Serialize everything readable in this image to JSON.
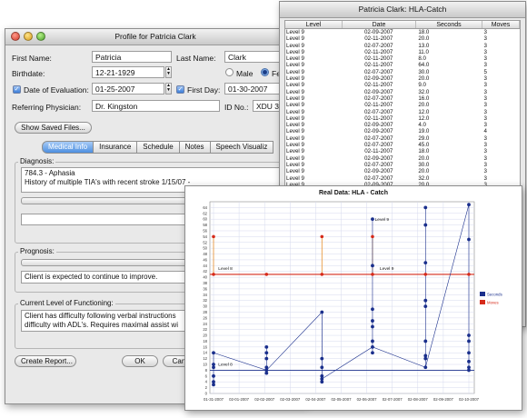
{
  "profile": {
    "title": "Profile for Patricia Clark",
    "first_name_label": "First Name:",
    "first_name": "Patricia",
    "last_name_label": "Last Name:",
    "last_name": "Clark",
    "birthdate_label": "Birthdate:",
    "birthdate": "12-21-1929",
    "gender_male": "Male",
    "gender_female": "Fe",
    "eval_label": "Date of Evaluation:",
    "eval_date": "01-25-2007",
    "first_day_label": "First Day:",
    "first_day": "01-30-2007",
    "physician_label": "Referring Physician:",
    "physician": "Dr. Kingston",
    "id_label": "ID No.:",
    "id_value": "XDU 34",
    "show_files": "Show Saved Files...",
    "tabs": [
      "Medical Info",
      "Insurance",
      "Schedule",
      "Notes",
      "Speech Visualiz"
    ],
    "diagnosis_label": "Diagnosis:",
    "diagnosis_line1": "784.3 - Aphasia",
    "diagnosis_line2": "History of multiple TIA's with recent stroke 1/15/07 -",
    "prognosis_label": "Prognosis:",
    "prognosis_text": "Client is expected to continue to improve.",
    "functioning_label": "Current Level of Functioning:",
    "functioning_line1": "Client has difficulty following verbal instructions",
    "functioning_line2": "difficulty with ADL's. Requires maximal assist wi",
    "create_report": "Create Report...",
    "ok": "OK",
    "cancel": "Canc"
  },
  "table": {
    "title": "Patricia Clark: HLA-Catch",
    "columns": [
      "Level",
      "Date",
      "Seconds",
      "Moves"
    ],
    "rows": [
      [
        "Level 9",
        "02-09-2007",
        "18.0",
        "3"
      ],
      [
        "Level 9",
        "02-11-2007",
        "20.0",
        "3"
      ],
      [
        "Level 9",
        "02-07-2007",
        "13.0",
        "3"
      ],
      [
        "Level 9",
        "02-11-2007",
        "11.0",
        "3"
      ],
      [
        "Level 9",
        "02-11-2007",
        "8.0",
        "3"
      ],
      [
        "Level 9",
        "02-11-2007",
        "64.0",
        "3"
      ],
      [
        "Level 9",
        "02-07-2007",
        "30.0",
        "5"
      ],
      [
        "Level 9",
        "02-09-2007",
        "20.0",
        "3"
      ],
      [
        "Level 9",
        "02-11-2007",
        "9.0",
        "3"
      ],
      [
        "Level 9",
        "02-09-2007",
        "32.0",
        "3"
      ],
      [
        "Level 9",
        "02-07-2007",
        "16.0",
        "3"
      ],
      [
        "Level 9",
        "02-11-2007",
        "20.0",
        "3"
      ],
      [
        "Level 9",
        "02-07-2007",
        "12.0",
        "3"
      ],
      [
        "Level 9",
        "02-11-2007",
        "12.0",
        "3"
      ],
      [
        "Level 9",
        "02-09-2007",
        "4.0",
        "3"
      ],
      [
        "Level 9",
        "02-09-2007",
        "19.0",
        "4"
      ],
      [
        "Level 9",
        "02-07-2007",
        "29.0",
        "3"
      ],
      [
        "Level 9",
        "02-07-2007",
        "45.0",
        "3"
      ],
      [
        "Level 9",
        "02-11-2007",
        "18.0",
        "3"
      ],
      [
        "Level 9",
        "02-09-2007",
        "20.0",
        "3"
      ],
      [
        "Level 9",
        "02-07-2007",
        "30.0",
        "3"
      ],
      [
        "Level 9",
        "02-09-2007",
        "20.0",
        "3"
      ],
      [
        "Level 9",
        "02-07-2007",
        "32.0",
        "3"
      ],
      [
        "Level 9",
        "02-09-2007",
        "20.0",
        "3"
      ],
      [
        "Level 9",
        "02-11-2007",
        "14.0",
        "3"
      ]
    ]
  },
  "chart_data": {
    "type": "scatter",
    "title": "Real Data: HLA - Catch",
    "x_ticks": [
      "01-31-2007",
      "02-01-2007",
      "02-02-2007",
      "02-03-2007",
      "02-04-2007",
      "02-05-2007",
      "02-06-2007",
      "02-07-2007",
      "02-08-2007",
      "02-09-2007",
      "02-10-2007"
    ],
    "y_ticks_left": [
      0,
      2,
      4,
      6,
      8,
      10,
      12,
      14,
      16,
      18,
      20,
      22,
      24,
      26,
      28,
      30,
      32,
      34,
      36,
      38,
      40,
      42,
      44,
      46,
      48,
      50,
      52,
      54,
      56,
      58,
      60,
      62,
      64
    ],
    "ylim": [
      0,
      66
    ],
    "legend": [
      "Seconds",
      "Moves"
    ],
    "legend_colors": [
      "#1a2f8c",
      "#d62a1a"
    ],
    "annotations": [
      "Level 8",
      "Level 9",
      "Level 9",
      "Level 8"
    ],
    "seconds_points": [
      {
        "x": 0,
        "y": 14
      },
      {
        "x": 0,
        "y": 10
      },
      {
        "x": 0,
        "y": 9
      },
      {
        "x": 0,
        "y": 6
      },
      {
        "x": 0,
        "y": 4
      },
      {
        "x": 0,
        "y": 3
      },
      {
        "x": 2.2,
        "y": 16
      },
      {
        "x": 2.2,
        "y": 14
      },
      {
        "x": 2.2,
        "y": 12
      },
      {
        "x": 2.2,
        "y": 9
      },
      {
        "x": 2.2,
        "y": 8
      },
      {
        "x": 2.2,
        "y": 7
      },
      {
        "x": 4.5,
        "y": 28
      },
      {
        "x": 4.5,
        "y": 12
      },
      {
        "x": 4.5,
        "y": 9
      },
      {
        "x": 4.5,
        "y": 6
      },
      {
        "x": 4.5,
        "y": 5
      },
      {
        "x": 4.5,
        "y": 4
      },
      {
        "x": 6.6,
        "y": 60
      },
      {
        "x": 6.6,
        "y": 44
      },
      {
        "x": 6.6,
        "y": 29
      },
      {
        "x": 6.6,
        "y": 25
      },
      {
        "x": 6.6,
        "y": 23
      },
      {
        "x": 6.6,
        "y": 18
      },
      {
        "x": 6.6,
        "y": 16
      },
      {
        "x": 6.6,
        "y": 14
      },
      {
        "x": 8.8,
        "y": 64
      },
      {
        "x": 8.8,
        "y": 58
      },
      {
        "x": 8.8,
        "y": 45
      },
      {
        "x": 8.8,
        "y": 32
      },
      {
        "x": 8.8,
        "y": 30
      },
      {
        "x": 8.8,
        "y": 18
      },
      {
        "x": 8.8,
        "y": 13
      },
      {
        "x": 8.8,
        "y": 12
      },
      {
        "x": 8.8,
        "y": 9
      },
      {
        "x": 10.6,
        "y": 65
      },
      {
        "x": 10.6,
        "y": 53
      },
      {
        "x": 10.6,
        "y": 20
      },
      {
        "x": 10.6,
        "y": 18
      },
      {
        "x": 10.6,
        "y": 14
      },
      {
        "x": 10.6,
        "y": 11
      },
      {
        "x": 10.6,
        "y": 9
      },
      {
        "x": 10.6,
        "y": 8
      }
    ],
    "seconds_line": [
      {
        "x": 0,
        "y": 14
      },
      {
        "x": 2.2,
        "y": 8
      },
      {
        "x": 4.5,
        "y": 28
      },
      {
        "x": 4.5,
        "y": 5
      },
      {
        "x": 6.6,
        "y": 16
      },
      {
        "x": 8.8,
        "y": 9
      },
      {
        "x": 10.6,
        "y": 65
      }
    ],
    "moves_points": [
      {
        "x": 0,
        "y": 54
      },
      {
        "x": 0,
        "y": 41
      },
      {
        "x": 2.2,
        "y": 41
      },
      {
        "x": 4.5,
        "y": 54
      },
      {
        "x": 4.5,
        "y": 41
      },
      {
        "x": 6.6,
        "y": 54
      },
      {
        "x": 6.6,
        "y": 41
      },
      {
        "x": 8.8,
        "y": 41
      },
      {
        "x": 10.6,
        "y": 41
      }
    ],
    "moves_level": 41,
    "seconds_baseline": 8
  }
}
